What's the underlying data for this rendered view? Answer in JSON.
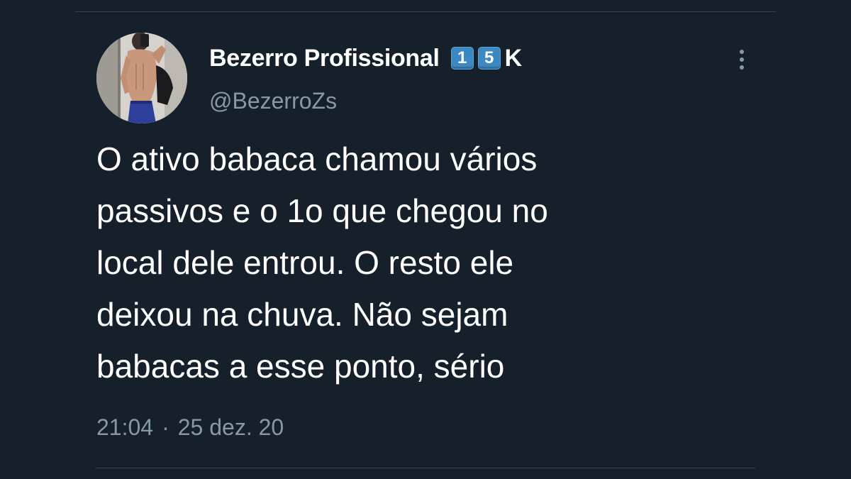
{
  "tweet": {
    "author": {
      "display_name": "Bezerro Profissional",
      "badge_digits": [
        "1",
        "5"
      ],
      "badge_suffix": "K",
      "handle": "@BezerroZs",
      "avatar_icon": "profile-photo"
    },
    "text_lines": [
      "O ativo babaca chamou vários",
      "passivos e o 1o que chegou no",
      "local dele entrou. O resto ele",
      "deixou na chuva. Não sejam",
      "babacas a esse ponto, sério"
    ],
    "time": "21:04",
    "separator": "·",
    "date": "25 dez. 20",
    "more_icon": "more-vertical-icon"
  },
  "colors": {
    "background": "#15202b",
    "text_primary": "#ffffff",
    "text_secondary": "#8899a6",
    "divider": "#38444d",
    "keycap_blue": "#3b88c3"
  }
}
